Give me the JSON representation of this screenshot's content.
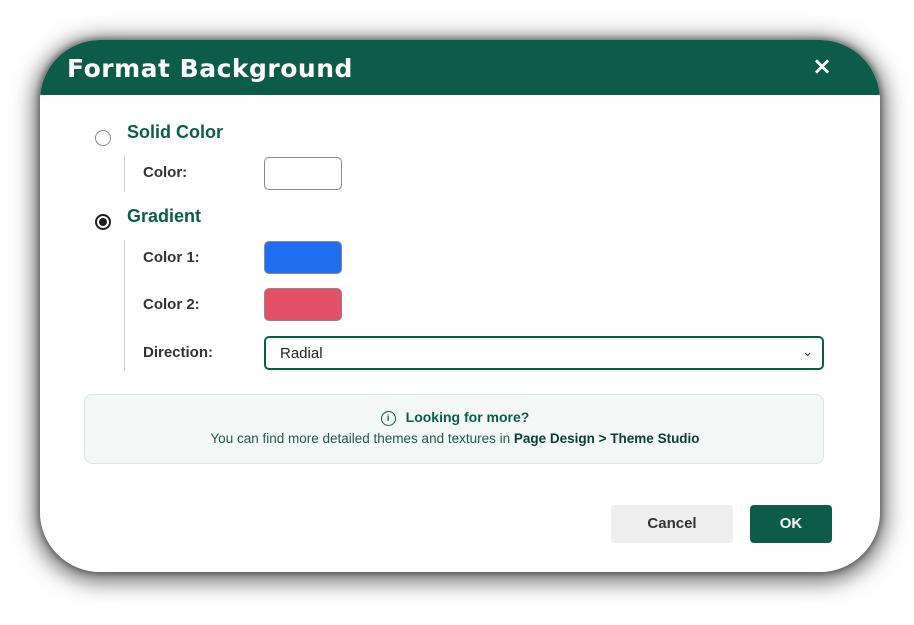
{
  "dialog": {
    "title": "Format Background",
    "close_glyph": "×"
  },
  "solid": {
    "label": "Solid Color",
    "selected": false,
    "color_label": "Color:",
    "color_value": "#ffffff"
  },
  "gradient": {
    "label": "Gradient",
    "selected": true,
    "color1_label": "Color 1:",
    "color1_value": "#1f6ef0",
    "color2_label": "Color 2:",
    "color2_value": "#e45166",
    "direction_label": "Direction:",
    "direction_value": "Radial"
  },
  "info": {
    "icon": "info-circle-icon",
    "heading": "Looking for more?",
    "text": "You can find more detailed themes and textures in",
    "path": "Page Design > Theme Studio"
  },
  "buttons": {
    "cancel": "Cancel",
    "ok": "OK"
  },
  "colors": {
    "brand": "#0d5c4a"
  }
}
